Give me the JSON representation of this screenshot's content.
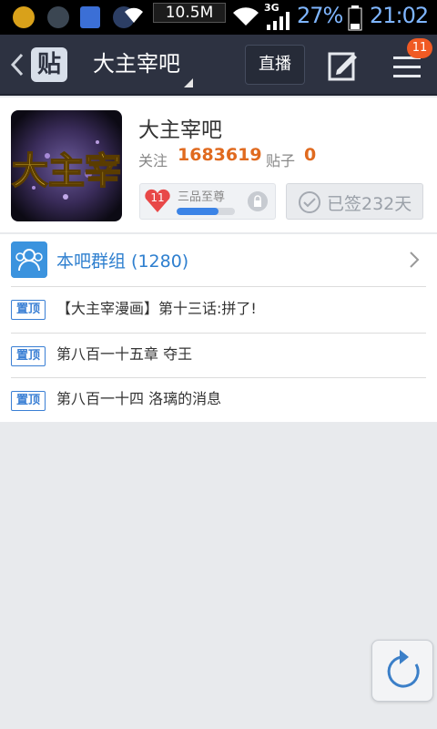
{
  "status_bar": {
    "net_speed": "10.5M",
    "network": "3G",
    "battery": "27%",
    "time": "21:02",
    "app_icons": [
      "green-app-icon",
      "qq-penguin-icon",
      "tieba-icon",
      "game-icon"
    ]
  },
  "nav": {
    "logo_text": "贴",
    "title": "大主宰吧",
    "live_label": "直播",
    "menu_badge": "11"
  },
  "forum": {
    "name": "大主宰吧",
    "follow_label": "关注",
    "follow_count": "1683619",
    "posts_label": "贴子",
    "posts_count": "0",
    "level_num": "11",
    "level_name": "三品至尊",
    "level_progress": 0.72,
    "sign_label": "已签232天",
    "avatar_text": "大主宰"
  },
  "group": {
    "label": "本吧群组 (1280)"
  },
  "top_posts": {
    "tag": "置顶",
    "items": [
      {
        "title": "【大主宰漫画】第十三话:拼了!"
      },
      {
        "title": "第八百一十五章  夺王"
      },
      {
        "title": "第八百一十四 洛璃的消息"
      }
    ]
  },
  "colors": {
    "nav_bg": "#2d3241",
    "accent_blue": "#3b83e6",
    "count_orange": "#e06a1f",
    "badge_orange": "#f05a24"
  }
}
